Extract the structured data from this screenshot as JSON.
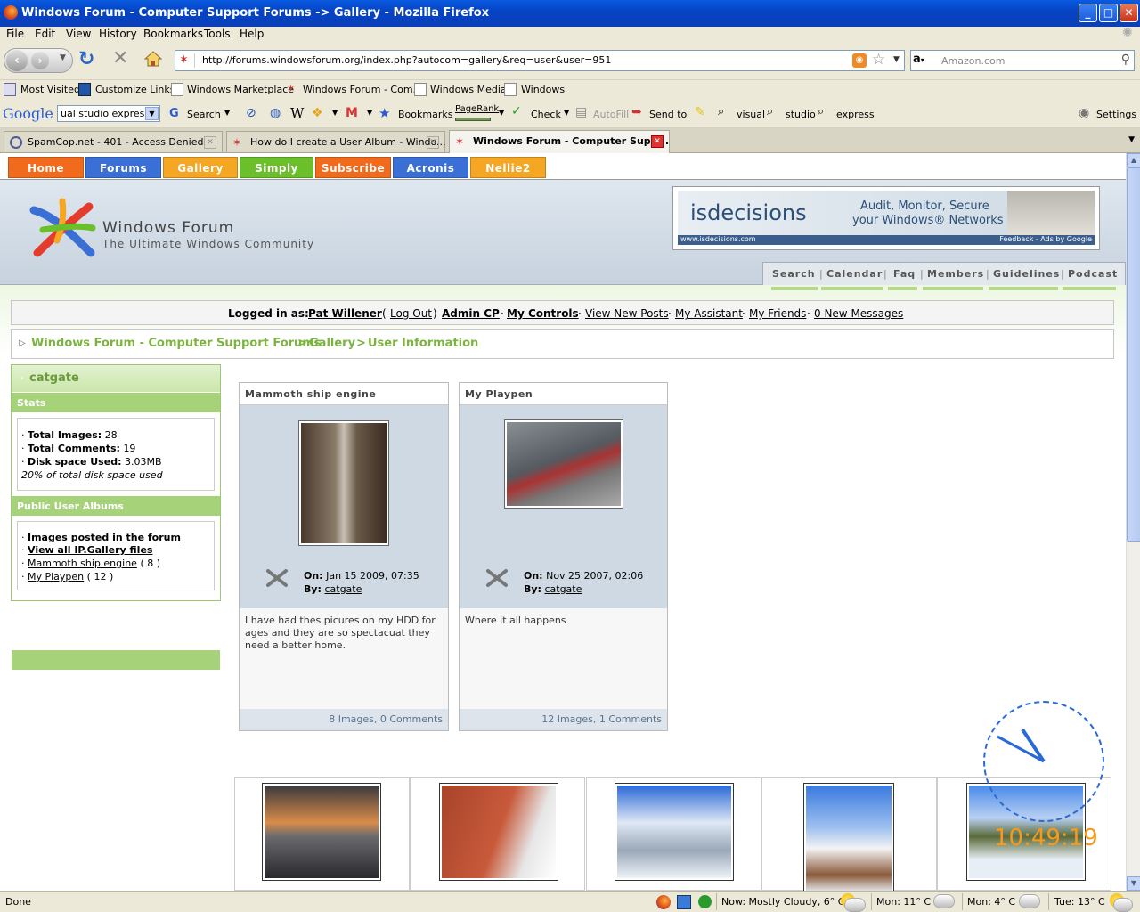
{
  "window": {
    "title": "Windows Forum - Computer Support Forums -> Gallery - Mozilla Firefox",
    "min": "_",
    "max": "□",
    "close": "✕"
  },
  "menu": [
    "File",
    "Edit",
    "View",
    "History",
    "Bookmarks",
    "Tools",
    "Help"
  ],
  "nav": {
    "url": "http://forums.windowsforum.org/index.php?autocom=gallery&req=user&user=951",
    "search_placeholder": "Amazon.com",
    "search_engine": "a"
  },
  "bookmarks": [
    "Most Visited",
    "Customize Links",
    "Windows Marketplace",
    "Windows Forum - Com...",
    "Windows Media",
    "Windows"
  ],
  "google_toolbar": {
    "logo": "Google",
    "query": "ual studio express",
    "search": "Search",
    "bookmarks": "Bookmarks",
    "pagerank": "PageRank",
    "check": "Check",
    "autofill": "AutoFill",
    "send_to": "Send to",
    "terms": [
      "visual",
      "studio",
      "express"
    ],
    "settings": "Settings"
  },
  "tabs": [
    {
      "label": "SpamCop.net - 401 - Access Denied",
      "active": false
    },
    {
      "label": "How do I create a User Album - Windo...",
      "active": false
    },
    {
      "label": "Windows Forum - Computer Supp...",
      "active": true
    }
  ],
  "site": {
    "nav": [
      {
        "label": "Home",
        "color": "#f26b1d"
      },
      {
        "label": "Forums",
        "color": "#3a6fd6"
      },
      {
        "label": "Gallery",
        "color": "#f5a623"
      },
      {
        "label": "Simply",
        "color": "#6bbf2a"
      },
      {
        "label": "Subscribe",
        "color": "#f26b1d"
      },
      {
        "label": "Acronis",
        "color": "#3a6fd6"
      },
      {
        "label": "Nellie2",
        "color": "#f5a623"
      }
    ],
    "logo_title": "Windows Forum",
    "logo_sub": "The Ultimate Windows Community",
    "ad": {
      "brand": "isdecisions",
      "tag1": "Audit, Monitor, Secure",
      "tag2": "your Windows® Networks",
      "url": "www.isdecisions.com",
      "feedback": "Feedback - Ads by Google"
    },
    "subnav": [
      "Search",
      "Calendar",
      "Faq",
      "Members",
      "Guidelines",
      "Podcast"
    ]
  },
  "login": {
    "prefix": "Logged in as:",
    "user": "Pat Willener",
    "logout": "Log Out",
    "admin": "Admin CP",
    "controls": "My Controls",
    "new_posts": "View New Posts",
    "assistant": "My Assistant",
    "friends": "My Friends",
    "messages": "0 New Messages"
  },
  "breadcrumb": [
    "Windows Forum - Computer Support Forums",
    "Gallery",
    "User Information"
  ],
  "sidebar": {
    "username": "catgate",
    "stats_header": "Stats",
    "total_images_label": "Total Images:",
    "total_images": "28",
    "total_comments_label": "Total Comments:",
    "total_comments": "19",
    "disk_label": "Disk space Used:",
    "disk": "3.03MB",
    "disk_pct": "20% of total disk space used",
    "albums_header": "Public User Albums",
    "links": [
      {
        "label": "Images posted in the forum",
        "count": ""
      },
      {
        "label": "View all IP.Gallery files",
        "count": ""
      },
      {
        "label": "Mammoth ship engine",
        "count": "( 8 )"
      },
      {
        "label": "My Playpen",
        "count": "( 12 )"
      }
    ]
  },
  "albums": [
    {
      "title": "Mammoth ship engine",
      "on_label": "On:",
      "on": "Jan 15 2009, 07:35",
      "by_label": "By:",
      "by": "catgate",
      "desc": "I have had thes picures on my HDD for ages and they are so spectacuat they need a better home.",
      "footer": "8 Images, 0 Comments"
    },
    {
      "title": "My Playpen",
      "on_label": "On:",
      "on": "Nov 25 2007, 02:06",
      "by_label": "By:",
      "by": "catgate",
      "desc": "Where it all happens",
      "footer": "12 Images, 1 Comments"
    }
  ],
  "clock": "10:49:19",
  "status": {
    "text": "Done",
    "weather_now": "Now: Mostly Cloudy, 6° C",
    "mon1": "Mon: 11° C",
    "mon2": "Mon: 4° C",
    "tue": "Tue: 13° C"
  }
}
